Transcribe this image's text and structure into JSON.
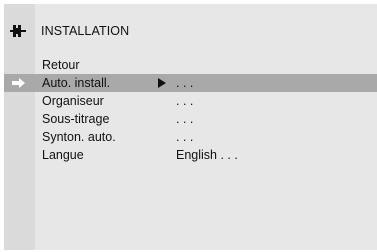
{
  "header": {
    "title": "INSTALLATION",
    "icon": "antenna-plug-icon"
  },
  "menu": {
    "selected_index": 1,
    "items": [
      {
        "label": "Retour",
        "value": ""
      },
      {
        "label": "Auto. install.",
        "value": ". . ."
      },
      {
        "label": "Organiseur",
        "value": ". . ."
      },
      {
        "label": "Sous-titrage",
        "value": ". . ."
      },
      {
        "label": "Synton. auto.",
        "value": ". . ."
      },
      {
        "label": "Langue",
        "value": "English . . ."
      }
    ]
  },
  "colors": {
    "panel": "#e7e7e7",
    "sidebar": "#dadada",
    "highlight": "#a9a9a9",
    "text": "#111111"
  }
}
